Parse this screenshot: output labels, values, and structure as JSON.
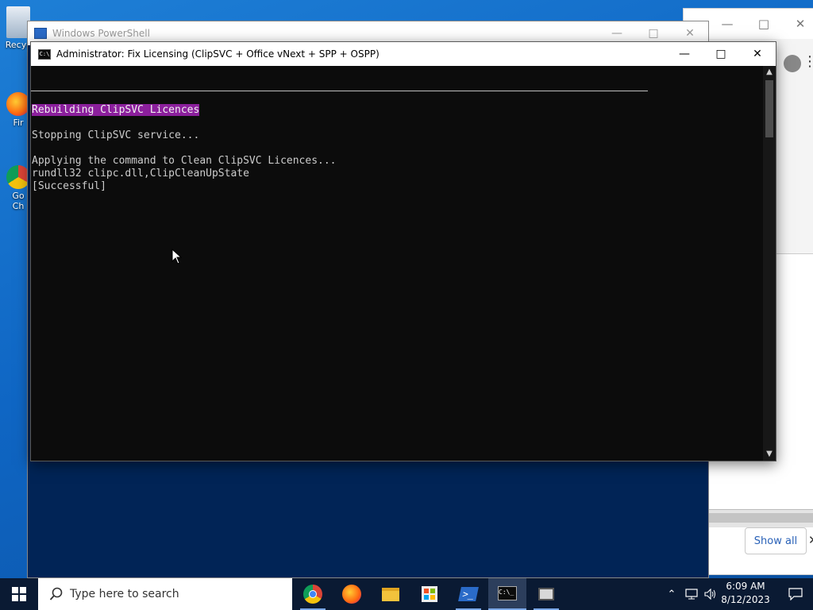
{
  "desktop": {
    "icons": [
      {
        "label": "Recyc"
      },
      {
        "label": "Fir"
      },
      {
        "label": "Go"
      },
      {
        "label": "Ch"
      }
    ]
  },
  "background_window": {
    "show_all_label": "Show all"
  },
  "powershell_window": {
    "title": "Windows PowerShell"
  },
  "console_window": {
    "title": "Administrator:  Fix Licensing (ClipSVC + Office vNext + SPP + OSPP)",
    "icon_text": "C:\\",
    "lines": {
      "heading": "Rebuilding ClipSVC Licences",
      "stopping": "Stopping ClipSVC service...",
      "applying": "Applying the command to Clean ClipSVC Licences...",
      "command": "rundll32 clipc.dll,ClipCleanUpState",
      "result": "[Successful]"
    },
    "heading_highlight_color": "#8b1f9c",
    "background_color": "#0c0c0c"
  },
  "taskbar": {
    "search_placeholder": "Type here to search",
    "apps": [
      "chrome-icon",
      "firefox-icon",
      "file-explorer-icon",
      "store-icon",
      "powershell-icon",
      "console-icon",
      "task-window-icon"
    ],
    "time": "6:09 AM",
    "date": "8/12/2023"
  }
}
